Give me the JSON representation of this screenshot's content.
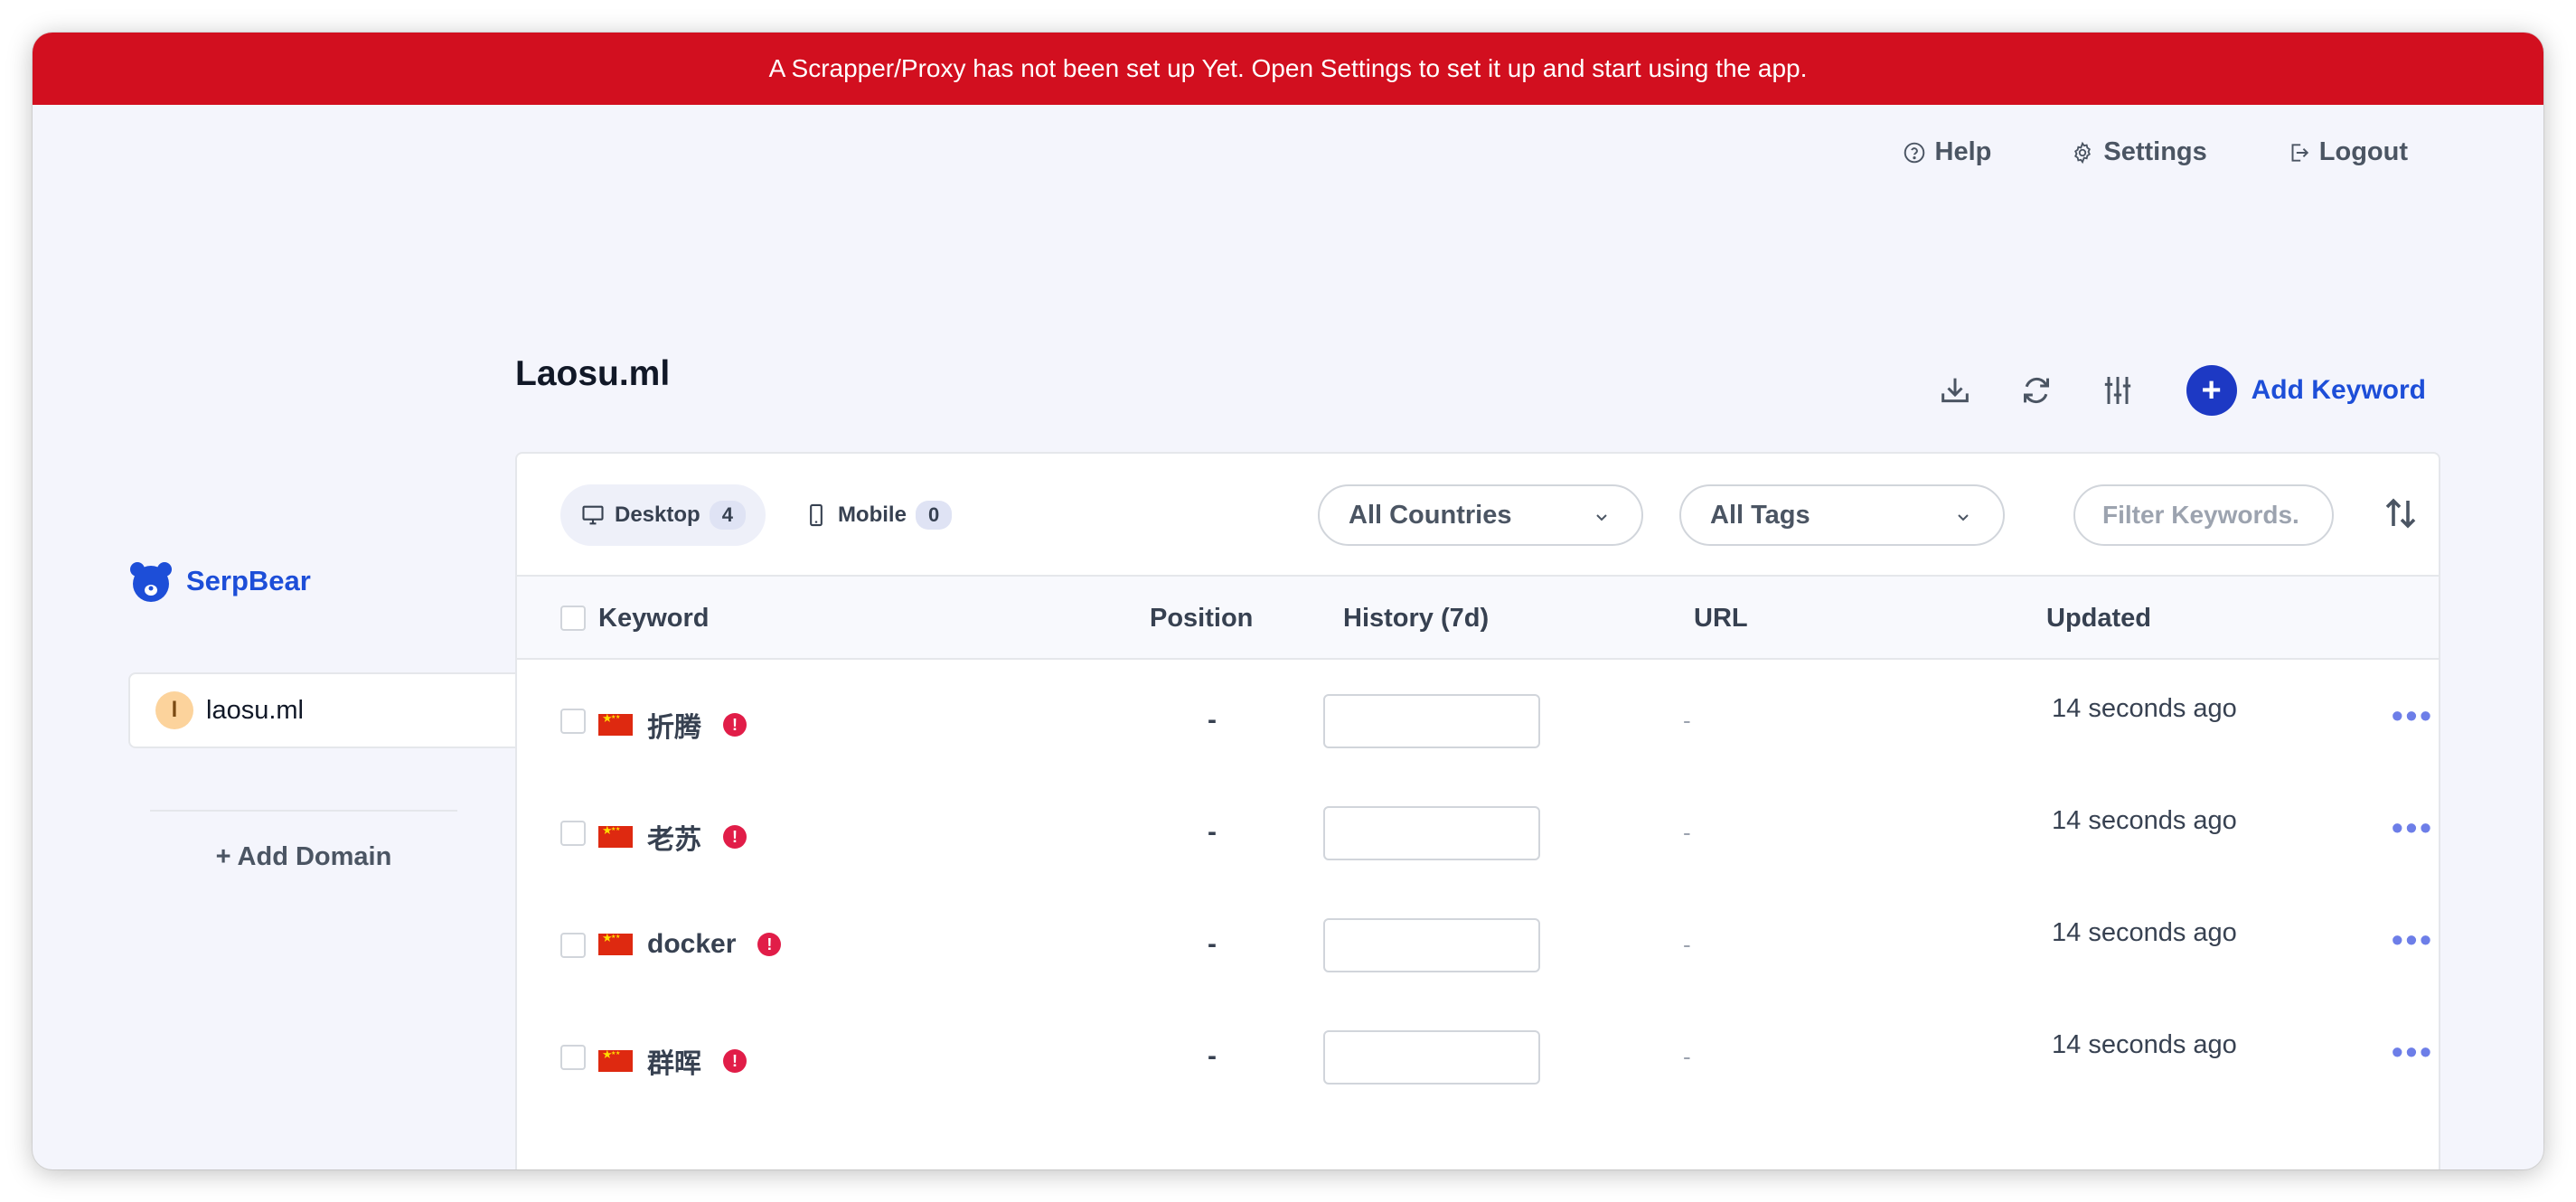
{
  "banner": {
    "text": "A Scrapper/Proxy has not been set up Yet. Open Settings to set it up and start using the app."
  },
  "nav": {
    "help": "Help",
    "settings": "Settings",
    "logout": "Logout"
  },
  "brand": {
    "name": "SerpBear",
    "color": "#1d4ed8"
  },
  "sidebar": {
    "domains": [
      {
        "initial": "l",
        "name": "laosu.ml"
      }
    ],
    "add_domain": "+ Add Domain"
  },
  "main": {
    "title": "Laosu.ml",
    "add_keyword": "Add Keyword",
    "tabs": [
      {
        "label": "Desktop",
        "count": "4",
        "icon": "desktop-icon",
        "active": true
      },
      {
        "label": "Mobile",
        "count": "0",
        "icon": "mobile-icon",
        "active": false
      }
    ],
    "country_select": "All Countries",
    "tags_select": "All Tags",
    "filter_placeholder": "Filter Keywords.",
    "columns": {
      "keyword": "Keyword",
      "position": "Position",
      "history": "History (7d)",
      "url": "URL",
      "updated": "Updated"
    },
    "rows": [
      {
        "keyword": "折腾",
        "position": "-",
        "url": "-",
        "updated": "14 seconds ago"
      },
      {
        "keyword": "老苏",
        "position": "-",
        "url": "-",
        "updated": "14 seconds ago"
      },
      {
        "keyword": "docker",
        "position": "-",
        "url": "-",
        "updated": "14 seconds ago"
      },
      {
        "keyword": "群晖",
        "position": "-",
        "url": "-",
        "updated": "14 seconds ago"
      }
    ]
  },
  "colors": {
    "banner": "#d20f1f",
    "accent": "#1d39c4",
    "error": "#e11d48"
  }
}
